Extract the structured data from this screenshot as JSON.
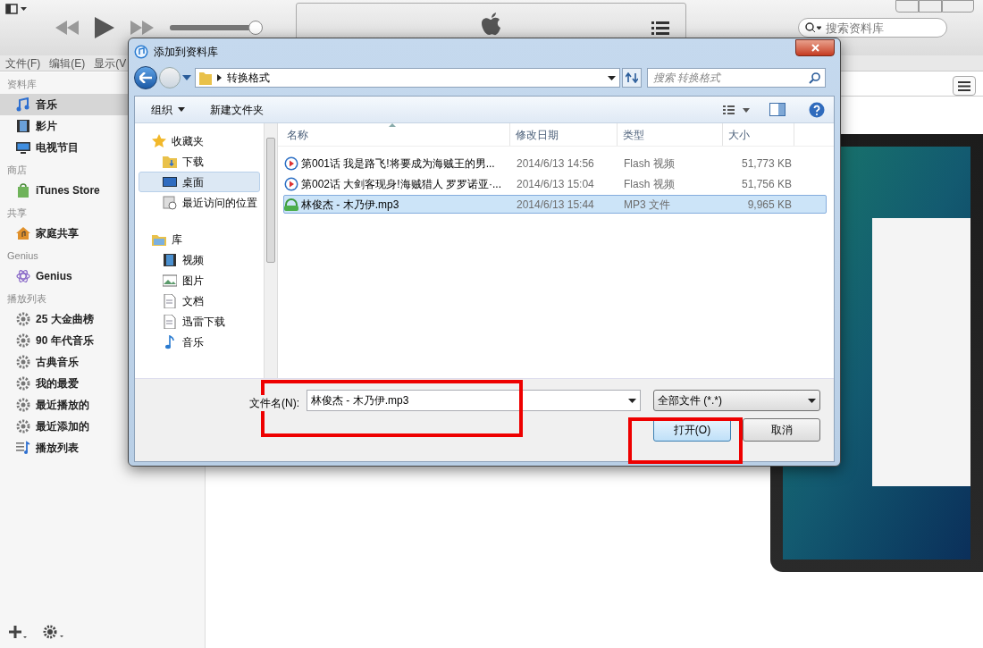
{
  "player": {
    "volume": {
      "level": 1.0
    },
    "search": {
      "placeholder": "搜索资料库"
    }
  },
  "menu": [
    "文件(F)",
    "编辑(E)",
    "显示(V"
  ],
  "sidebar": {
    "sections": [
      {
        "title": "资料库",
        "items": [
          {
            "label": "音乐",
            "kind": "music",
            "selected": true
          },
          {
            "label": "影片",
            "kind": "film",
            "selected": false
          },
          {
            "label": "电视节目",
            "kind": "tv",
            "selected": false
          }
        ]
      },
      {
        "title": "商店",
        "items": [
          {
            "label": "iTunes Store",
            "kind": "store",
            "selected": false
          }
        ]
      },
      {
        "title": "共享",
        "items": [
          {
            "label": "家庭共享",
            "kind": "home",
            "selected": false
          }
        ]
      },
      {
        "title": "Genius",
        "items": [
          {
            "label": "Genius",
            "kind": "genius",
            "selected": false
          }
        ]
      },
      {
        "title": "播放列表",
        "items": [
          {
            "label": "25 大金曲榜",
            "kind": "smart",
            "selected": false
          },
          {
            "label": "90 年代音乐",
            "kind": "smart",
            "selected": false
          },
          {
            "label": "古典音乐",
            "kind": "smart",
            "selected": false
          },
          {
            "label": "我的最爱",
            "kind": "smart",
            "selected": false
          },
          {
            "label": "最近播放的",
            "kind": "smart",
            "selected": false
          },
          {
            "label": "最近添加的",
            "kind": "smart",
            "selected": false
          },
          {
            "label": "播放列表",
            "kind": "playlist",
            "selected": false
          }
        ]
      }
    ]
  },
  "dialog": {
    "title": "添加到资料库",
    "path": "转换格式",
    "search_placeholder": "搜索 转换格式",
    "toolbar": [
      "组织",
      "新建文件夹"
    ],
    "nav": [
      {
        "label": "收藏夹",
        "kind": "star",
        "selected": false,
        "children": [
          {
            "label": "下载",
            "kind": "download",
            "selected": false
          },
          {
            "label": "桌面",
            "kind": "desktop",
            "selected": true
          },
          {
            "label": "最近访问的位置",
            "kind": "recent",
            "selected": false
          }
        ]
      },
      {
        "label": "库",
        "kind": "library",
        "selected": false,
        "children": [
          {
            "label": "视频",
            "kind": "video",
            "selected": false
          },
          {
            "label": "图片",
            "kind": "picture",
            "selected": false
          },
          {
            "label": "文档",
            "kind": "doc",
            "selected": false
          },
          {
            "label": "迅雷下载",
            "kind": "doc",
            "selected": false
          },
          {
            "label": "音乐",
            "kind": "music",
            "selected": false
          }
        ]
      }
    ],
    "columns": [
      "名称",
      "修改日期",
      "类型",
      "大小"
    ],
    "files": [
      {
        "name": "第001话 我是路飞!将要成为海贼王的男...",
        "modified": "2014/6/13 14:56",
        "type": "Flash 视频",
        "size": "51,773 KB",
        "kind": "video",
        "selected": false
      },
      {
        "name": "第002话 大剑客现身!海贼猎人 罗罗诺亚·...",
        "modified": "2014/6/13 15:04",
        "type": "Flash 视频",
        "size": "51,756 KB",
        "kind": "video",
        "selected": false
      },
      {
        "name": "林俊杰 - 木乃伊.mp3",
        "modified": "2014/6/13 15:44",
        "type": "MP3 文件",
        "size": "9,965 KB",
        "kind": "audio",
        "selected": true
      }
    ],
    "filename_label": "文件名(N):",
    "filename": "林俊杰 - 木乃伊.mp3",
    "filter": "全部文件 (*.*)",
    "buttons": [
      {
        "label": "打开(O)",
        "kind": "primary"
      },
      {
        "label": "取消",
        "kind": "normal"
      }
    ]
  }
}
